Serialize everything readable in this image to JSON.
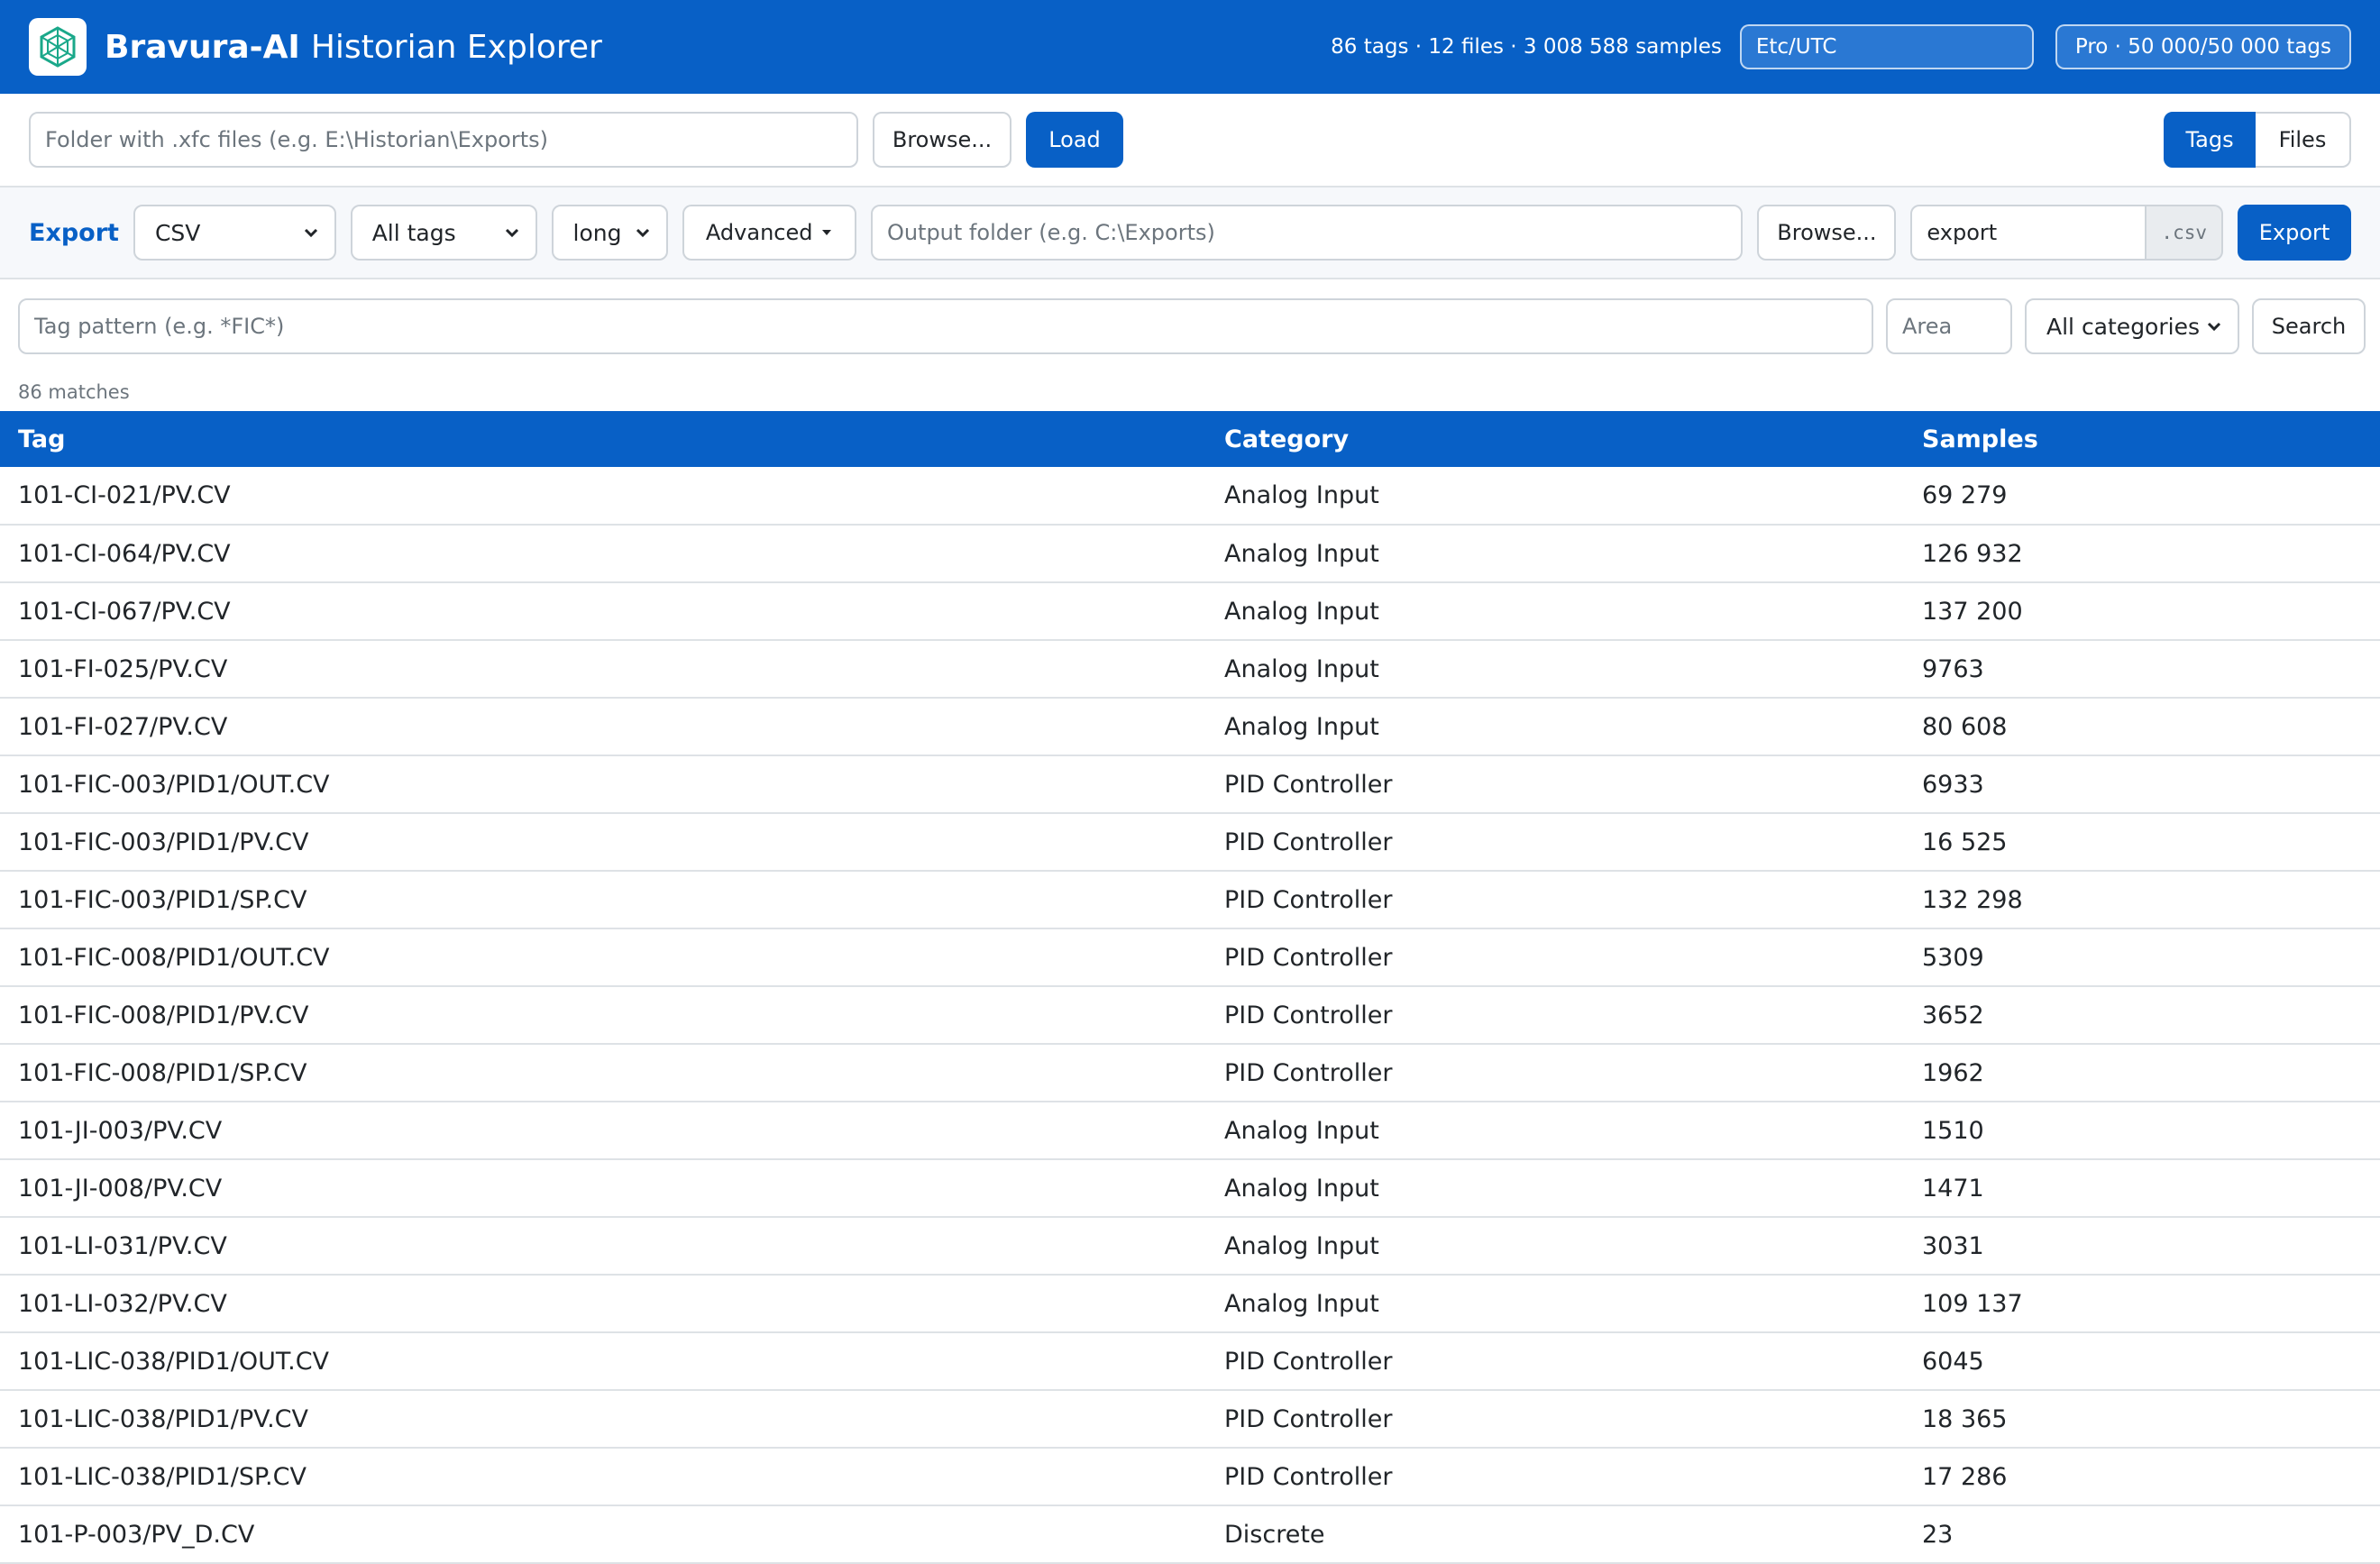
{
  "header": {
    "brand": "Bravura-AI",
    "subtitle": "Historian Explorer",
    "stats": "86 tags · 12 files · 3 008 588 samples",
    "timezone": "Etc/UTC",
    "license": "Pro · 50 000/50 000 tags",
    "accent": "#0860c6"
  },
  "load": {
    "folder_placeholder": "Folder with .xfc files (e.g. E:\\Historian\\Exports)",
    "browse_label": "Browse...",
    "load_label": "Load",
    "tab_tags": "Tags",
    "tab_files": "Files"
  },
  "export": {
    "label": "Export",
    "format": "CSV",
    "scope": "All tags",
    "layout": "long",
    "advanced_label": "Advanced",
    "output_placeholder": "Output folder (e.g. C:\\Exports)",
    "browse_label": "Browse...",
    "filename": "export",
    "extension": ".csv",
    "export_label": "Export"
  },
  "filter": {
    "pattern_placeholder": "Tag pattern (e.g. *FIC*)",
    "area_placeholder": "Area",
    "category": "All categories",
    "search_label": "Search",
    "matches": "86 matches"
  },
  "table": {
    "headers": [
      "Tag",
      "Category",
      "Samples"
    ],
    "rows": [
      [
        "101-CI-021/PV.CV",
        "Analog Input",
        "69 279"
      ],
      [
        "101-CI-064/PV.CV",
        "Analog Input",
        "126 932"
      ],
      [
        "101-CI-067/PV.CV",
        "Analog Input",
        "137 200"
      ],
      [
        "101-FI-025/PV.CV",
        "Analog Input",
        "9763"
      ],
      [
        "101-FI-027/PV.CV",
        "Analog Input",
        "80 608"
      ],
      [
        "101-FIC-003/PID1/OUT.CV",
        "PID Controller",
        "6933"
      ],
      [
        "101-FIC-003/PID1/PV.CV",
        "PID Controller",
        "16 525"
      ],
      [
        "101-FIC-003/PID1/SP.CV",
        "PID Controller",
        "132 298"
      ],
      [
        "101-FIC-008/PID1/OUT.CV",
        "PID Controller",
        "5309"
      ],
      [
        "101-FIC-008/PID1/PV.CV",
        "PID Controller",
        "3652"
      ],
      [
        "101-FIC-008/PID1/SP.CV",
        "PID Controller",
        "1962"
      ],
      [
        "101-JI-003/PV.CV",
        "Analog Input",
        "1510"
      ],
      [
        "101-JI-008/PV.CV",
        "Analog Input",
        "1471"
      ],
      [
        "101-LI-031/PV.CV",
        "Analog Input",
        "3031"
      ],
      [
        "101-LI-032/PV.CV",
        "Analog Input",
        "109 137"
      ],
      [
        "101-LIC-038/PID1/OUT.CV",
        "PID Controller",
        "6045"
      ],
      [
        "101-LIC-038/PID1/PV.CV",
        "PID Controller",
        "18 365"
      ],
      [
        "101-LIC-038/PID1/SP.CV",
        "PID Controller",
        "17 286"
      ],
      [
        "101-P-003/PV_D.CV",
        "Discrete",
        "23"
      ]
    ]
  }
}
